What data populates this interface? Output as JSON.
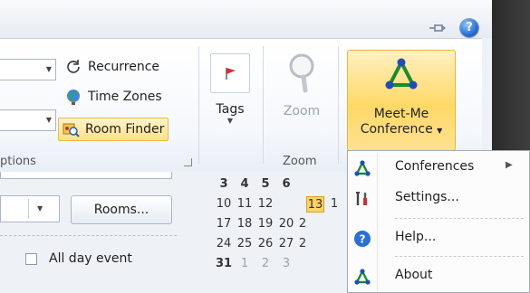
{
  "colors": {
    "accent": "#ffd866",
    "today": "#ffd36a",
    "icon_green": "#1c8a2e",
    "icon_blue": "#1f4fb5"
  },
  "ribbon": {
    "options_group": {
      "recurrence_label": "Recurrence",
      "time_zones_label": "Time Zones",
      "room_finder_label": "Room Finder",
      "group_label": "ptions"
    },
    "tags": {
      "label": "Tags"
    },
    "zoom": {
      "button_label": "Zoom",
      "group_label": "Zoom"
    },
    "meet_me": {
      "line1": "Meet-Me",
      "line2": "Conference"
    }
  },
  "form": {
    "rooms_button": "Rooms...",
    "all_day_label": "All day event"
  },
  "calendar": {
    "rows": [
      [
        "3",
        "4",
        "5",
        "6"
      ],
      [
        "10",
        "11",
        "12",
        "13",
        "1"
      ],
      [
        "17",
        "18",
        "19",
        "20",
        "2"
      ],
      [
        "24",
        "25",
        "26",
        "27",
        "2"
      ],
      [
        "31",
        "1",
        "2",
        "3"
      ]
    ],
    "today": "13"
  },
  "menu": {
    "items": [
      {
        "label": "Conferences",
        "icon": "meet-me-triangle-icon",
        "has_submenu": true
      },
      {
        "label": "Settings...",
        "icon": "tools-icon",
        "has_submenu": false
      },
      {
        "label": "Help...",
        "icon": "help-icon",
        "has_submenu": false
      },
      {
        "label": "About",
        "icon": "meet-me-triangle-icon",
        "has_submenu": false
      }
    ]
  }
}
